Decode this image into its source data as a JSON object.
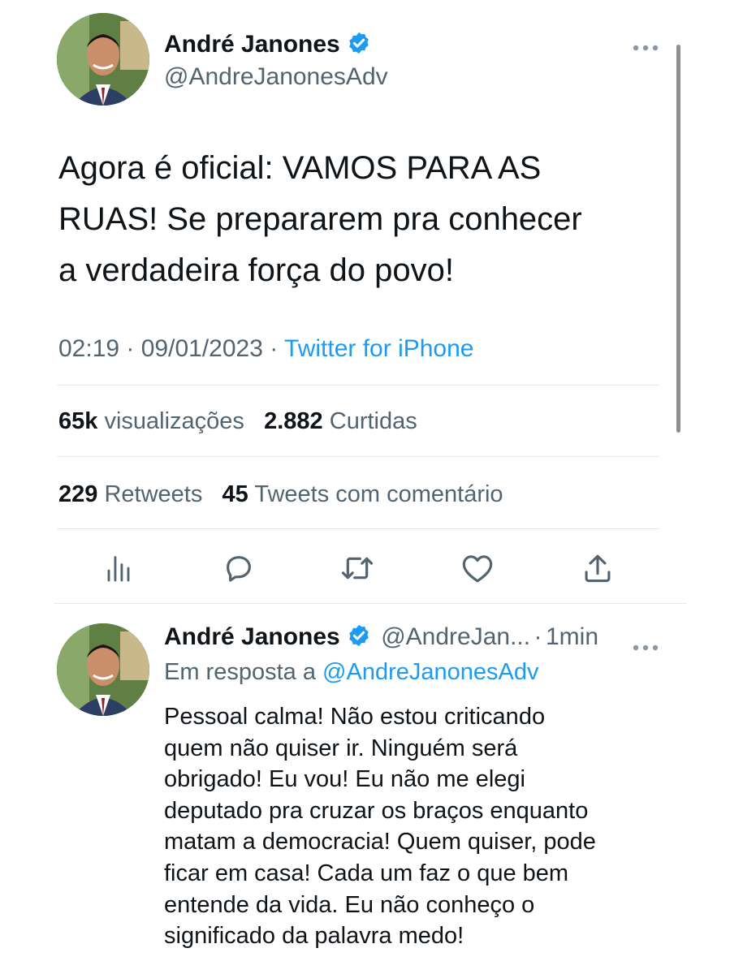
{
  "tweet": {
    "author_name": "André Janones",
    "author_handle": "@AndreJanonesAdv",
    "text_lines": [
      "Agora é oficial: VAMOS PARA AS",
      "RUAS! Se prepararem pra conhecer",
      "a verdadeira força do povo!"
    ],
    "time": "02:19",
    "date": "09/01/2023",
    "source": "Twitter for iPhone",
    "views_count": "65k",
    "views_label": "visualizações",
    "likes_count": "2.882",
    "likes_label": "Curtidas",
    "retweets_count": "229",
    "retweets_label": "Retweets",
    "quotes_count": "45",
    "quotes_label": "Tweets com comentário",
    "more_icon": "more-dots-icon",
    "verified_icon": "verified-badge-icon"
  },
  "actions": [
    {
      "name": "analytics-icon"
    },
    {
      "name": "reply-icon"
    },
    {
      "name": "retweet-icon"
    },
    {
      "name": "like-icon"
    },
    {
      "name": "share-icon"
    }
  ],
  "reply": {
    "author_name": "André Janones",
    "author_handle_truncated": "@AndreJan...",
    "separator": "·",
    "age": "1min",
    "replying_to_label": "Em resposta a",
    "replying_to_handle": "@AndreJanonesAdv",
    "text_lines": [
      "Pessoal calma! Não estou criticando",
      "quem não quiser ir. Ninguém será",
      "obrigado! Eu vou! Eu não me elegi",
      "deputado pra cruzar os braços enquanto",
      "matam a democracia! Quem quiser, pode",
      "ficar em casa! Cada um faz o que bem",
      "entende da vida. Eu não conheço o",
      "significado da palavra medo!"
    ]
  },
  "colors": {
    "text": "#0f1419",
    "secondary": "#536471",
    "accent": "#1d9bf0",
    "divider": "#e6e9ec"
  }
}
